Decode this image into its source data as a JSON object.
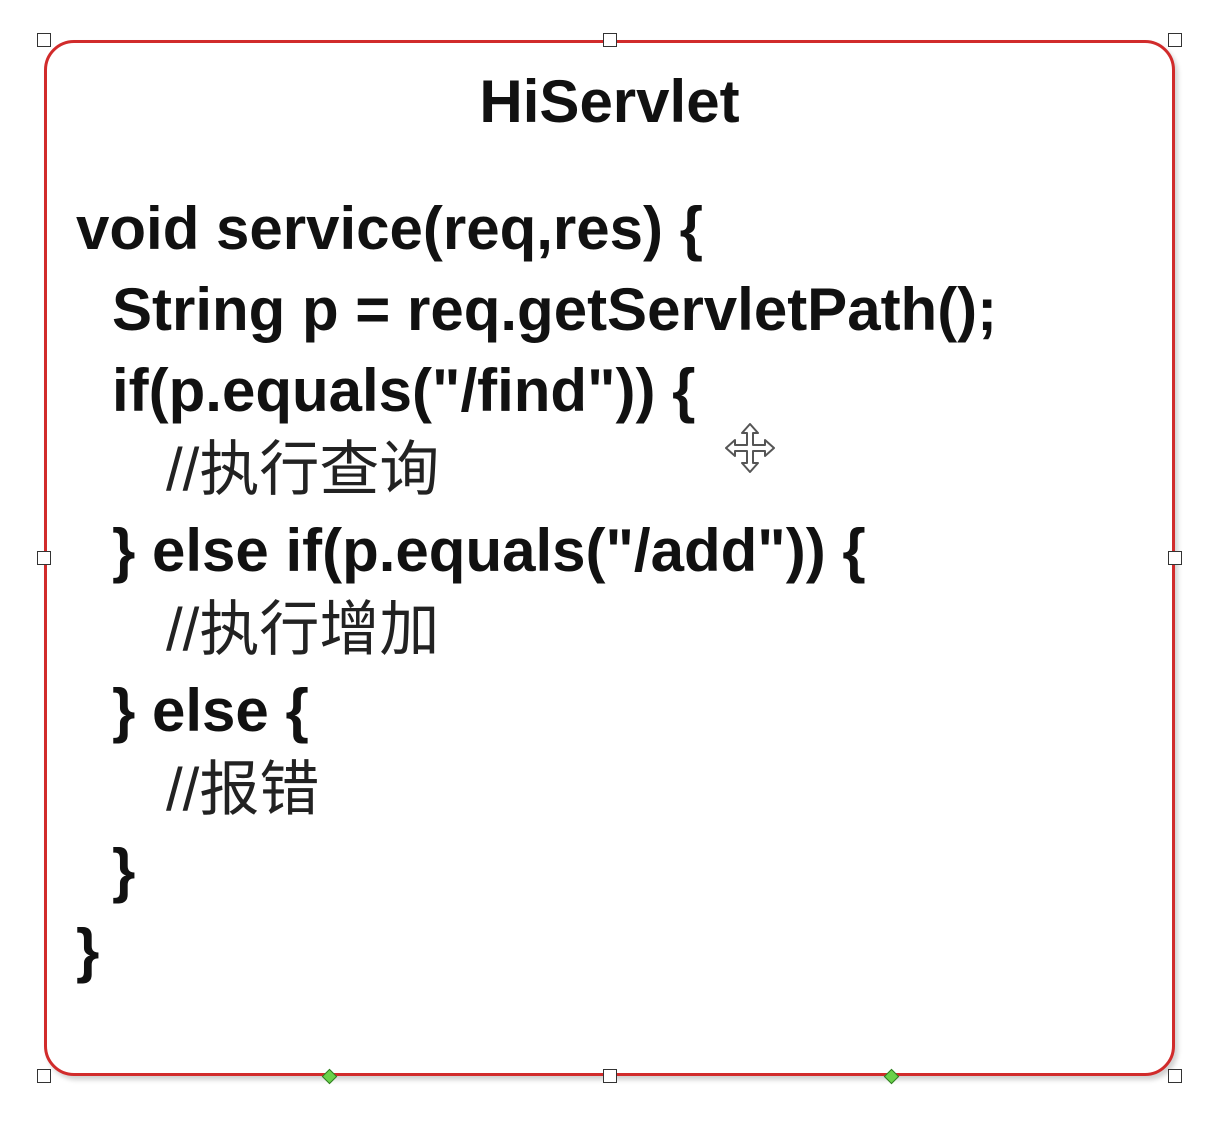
{
  "shape": {
    "title": "HiServlet",
    "border_color": "#d12b2b",
    "code_lines": [
      "void service(req,res) {",
      "String p = req.getServletPath();",
      "if(p.equals(\"/find\")) {",
      "//执行查询",
      "} else if(p.equals(\"/add\")) {",
      "//执行增加",
      "} else {",
      "//报错",
      "}",
      "}"
    ]
  },
  "selection": {
    "handle_icon": "resize-handle-icon",
    "adjust_icon": "adjustment-handle-icon",
    "cursor_icon": "move-cursor-icon"
  }
}
